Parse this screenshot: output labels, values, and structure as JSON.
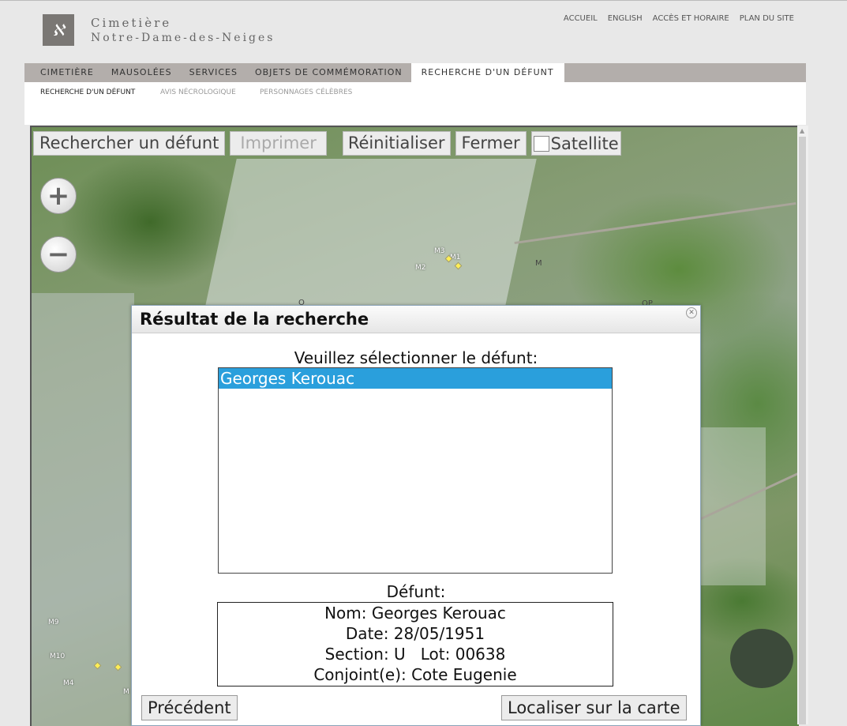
{
  "header": {
    "logo_glyph": "ℵ",
    "brand_line1": "Cimetière",
    "brand_line2": "Notre-Dame-des-Neiges",
    "utility": [
      "ACCUEIL",
      "ENGLISH",
      "ACCÈS ET HORAIRE",
      "PLAN DU SITE"
    ]
  },
  "nav": {
    "main": [
      "CIMETIÈRE",
      "MAUSOLÉES",
      "SERVICES",
      "OBJETS DE COMMÉMORATION",
      "RECHERCHE D'UN DÉFUNT"
    ],
    "active_main": "RECHERCHE D'UN DÉFUNT",
    "sub": [
      "RECHERCHE D'UN DÉFUNT",
      "AVIS NÉCROLOGIQUE",
      "PERSONNAGES CÉLÈBRES"
    ]
  },
  "map": {
    "toolbar": {
      "search": "Rechercher un défunt",
      "print": "Imprimer",
      "reset": "Réinitialiser",
      "close": "Fermer",
      "satellite": "Satellite",
      "satellite_checked": false
    },
    "zoom_in": "+",
    "zoom_out": "−",
    "labels": [
      "M3",
      "M1",
      "M2",
      "M",
      "O",
      "OP",
      "M9",
      "M10",
      "M4",
      "M"
    ]
  },
  "dialog": {
    "title": "Résultat de la recherche",
    "prompt": "Veuillez sélectionner le défunt:",
    "results": [
      "Georges Kerouac"
    ],
    "selected": "Georges Kerouac",
    "details_label": "Défunt:",
    "details": {
      "nom": "Nom: Georges Kerouac",
      "date": "Date: 28/05/1951",
      "section_lot": "Section: U   Lot: 00638",
      "conjoint": "Conjoint(e): Cote Eugenie"
    },
    "prev_button": "Précédent",
    "locate_button": "Localiser sur la carte"
  },
  "colors": {
    "nav_bg": "#b3aeab",
    "selected_row": "#2a9fdc",
    "logo_bg": "#7a7774"
  }
}
